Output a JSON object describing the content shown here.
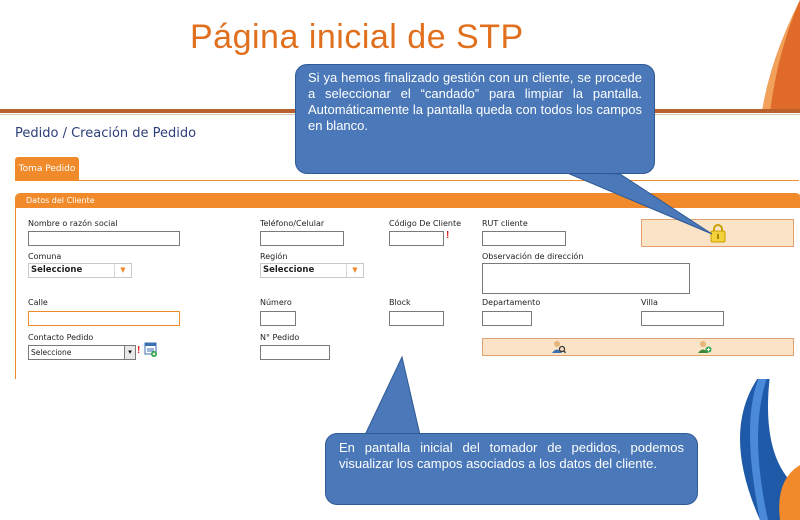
{
  "slide": {
    "title": "Página inicial de STP"
  },
  "page": {
    "heading": "Pedido / Creación de Pedido",
    "tab_label": "Toma Pedido"
  },
  "panel": {
    "header": "Datos del Cliente",
    "fields": {
      "nombre_label": "Nombre o razón social",
      "telefono_label": "Teléfono/Celular",
      "codigo_label": "Código De Cliente",
      "rut_label": "RUT cliente",
      "comuna_label": "Comuna",
      "comuna_value": "Seleccione",
      "region_label": "Región",
      "region_value": "Seleccione",
      "observacion_label": "Observación de dirección",
      "calle_label": "Calle",
      "numero_label": "Número",
      "block_label": "Block",
      "departamento_label": "Departamento",
      "villa_label": "Villa",
      "contacto_label": "Contacto Pedido",
      "contacto_value": "Seleccione",
      "npedido_label": "N° Pedido"
    },
    "required_marker": "!"
  },
  "callouts": {
    "top": "Si ya hemos finalizado gestión con un cliente, se procede a seleccionar el “candado” para limpiar la pantalla. Automáticamente la pantalla queda con todos los campos en blanco.",
    "bottom": "En pantalla inicial del tomador de pedidos, podemos visualizar los campos asociados a los datos del cliente."
  },
  "icons": {
    "lock": "lock-icon",
    "search_user": "user-search-icon",
    "add_user": "user-add-icon",
    "contact_add": "contact-add-icon"
  },
  "colors": {
    "title_orange": "#e0701e",
    "tab_orange": "#f08a2a",
    "heading_blue": "#2d3f7a",
    "callout_blue": "#4a78b8"
  }
}
